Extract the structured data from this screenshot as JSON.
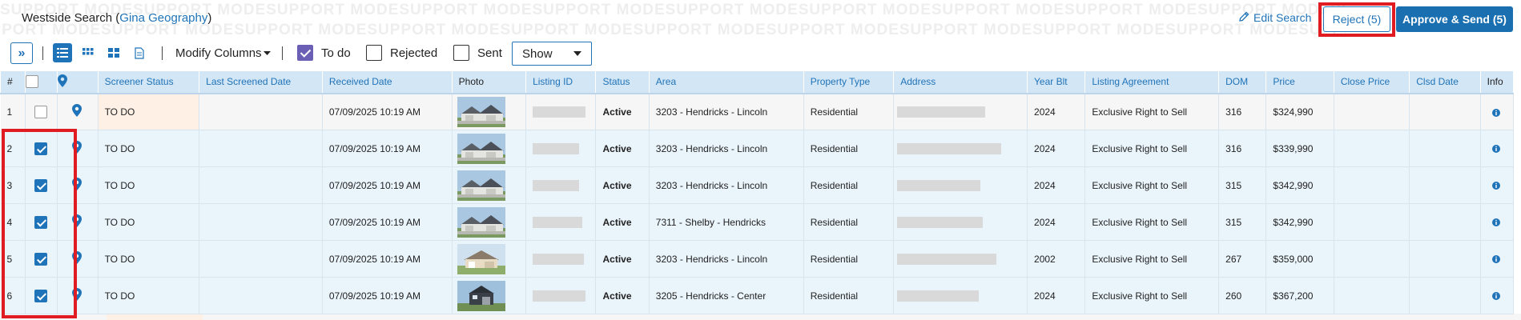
{
  "watermark": "SUPPORT MODESUPPORT MODESUPPORT MODESUPPORT MODESUPPORT MODESUPPORT MODESUPPORT MODESUPPORT MODESUPPORT MODESUPPORT MODESUPPORT MODESUPPORT MODE",
  "header": {
    "title": "Westside Search",
    "agent_open": " (",
    "agent": "Gina Geography",
    "agent_close": ")",
    "edit_search": "Edit Search",
    "reject_label": "Reject (5)",
    "approve_label": "Approve & Send (5)"
  },
  "toolbar": {
    "expand_glyph": "»",
    "modify_columns": "Modify Columns",
    "filters": [
      {
        "label": "To do",
        "checked": true
      },
      {
        "label": "Rejected",
        "checked": false
      },
      {
        "label": "Sent",
        "checked": false
      }
    ],
    "show_value": "Show"
  },
  "colors": {
    "accent": "#1f73b8",
    "active_green": "#2a8a18",
    "todo_orange": "#c06018",
    "highlight_red": "#e01b22",
    "checkbox_purple": "#6b5fb5"
  },
  "table": {
    "columns": [
      "#",
      "",
      "",
      "Screener Status",
      "Last Screened Date",
      "Received Date",
      "Photo",
      "Listing ID",
      "Status",
      "Area",
      "Property Type",
      "Address",
      "Year Blt",
      "Listing Agreement",
      "DOM",
      "Price",
      "Close Price",
      "Clsd Date",
      "Info"
    ],
    "rows": [
      {
        "num": "1",
        "selected": false,
        "screener": "TO DO",
        "last_screened": "",
        "received": "07/09/2025 10:19 AM",
        "status": "Active",
        "area": "3203 - Hendricks - Lincoln",
        "type": "Residential",
        "year": "2024",
        "agreement": "Exclusive Right to Sell",
        "dom": "316",
        "price": "$324,990",
        "close_price": "",
        "clsd_date": ""
      },
      {
        "num": "2",
        "selected": true,
        "screener": "TO DO",
        "last_screened": "",
        "received": "07/09/2025 10:19 AM",
        "status": "Active",
        "area": "3203 - Hendricks - Lincoln",
        "type": "Residential",
        "year": "2024",
        "agreement": "Exclusive Right to Sell",
        "dom": "316",
        "price": "$339,990",
        "close_price": "",
        "clsd_date": ""
      },
      {
        "num": "3",
        "selected": true,
        "screener": "TO DO",
        "last_screened": "",
        "received": "07/09/2025 10:19 AM",
        "status": "Active",
        "area": "3203 - Hendricks - Lincoln",
        "type": "Residential",
        "year": "2024",
        "agreement": "Exclusive Right to Sell",
        "dom": "315",
        "price": "$342,990",
        "close_price": "",
        "clsd_date": ""
      },
      {
        "num": "4",
        "selected": true,
        "screener": "TO DO",
        "last_screened": "",
        "received": "07/09/2025 10:19 AM",
        "status": "Active",
        "area": "7311 - Shelby - Hendricks",
        "type": "Residential",
        "year": "2024",
        "agreement": "Exclusive Right to Sell",
        "dom": "315",
        "price": "$342,990",
        "close_price": "",
        "clsd_date": ""
      },
      {
        "num": "5",
        "selected": true,
        "screener": "TO DO",
        "last_screened": "",
        "received": "07/09/2025 10:19 AM",
        "status": "Active",
        "area": "3203 - Hendricks - Lincoln",
        "type": "Residential",
        "year": "2002",
        "agreement": "Exclusive Right to Sell",
        "dom": "267",
        "price": "$359,000",
        "close_price": "",
        "clsd_date": ""
      },
      {
        "num": "6",
        "selected": true,
        "screener": "TO DO",
        "last_screened": "",
        "received": "07/09/2025 10:19 AM",
        "status": "Active",
        "area": "3205 - Hendricks - Center",
        "type": "Residential",
        "year": "2024",
        "agreement": "Exclusive Right to Sell",
        "dom": "260",
        "price": "$367,200",
        "close_price": "",
        "clsd_date": ""
      }
    ]
  }
}
